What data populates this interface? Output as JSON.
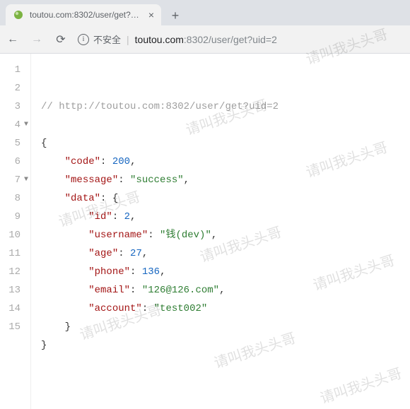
{
  "tab": {
    "title": "toutou.com:8302/user/get?uid=2",
    "close": "×"
  },
  "newTab": "+",
  "nav": {
    "back": "←",
    "forward": "→",
    "reload": "⟳"
  },
  "siteInfo": {
    "icon": "i",
    "label": "不安全"
  },
  "url": {
    "host": "toutou.com",
    "port": ":8302",
    "path": "/user/get?uid=2"
  },
  "watermark": "请叫我头头哥",
  "code": {
    "commentPrefix": "// ",
    "commentUrl": "http://toutou.com:8302/user/get?uid=2",
    "braceOpen": "{",
    "braceClose": "}",
    "comma": ",",
    "colon": ": ",
    "keys": {
      "code": "\"code\"",
      "message": "\"message\"",
      "data": "\"data\"",
      "id": "\"id\"",
      "username": "\"username\"",
      "age": "\"age\"",
      "phone": "\"phone\"",
      "email": "\"email\"",
      "account": "\"account\""
    },
    "values": {
      "code": "200",
      "message": "\"success\"",
      "id": "2",
      "username": "\"钱(dev)\"",
      "age": "27",
      "phone": "136",
      "email": "\"126@126.com\"",
      "account": "\"test002\""
    }
  },
  "lineNumbers": [
    "1",
    "2",
    "3",
    "4",
    "5",
    "6",
    "7",
    "8",
    "9",
    "10",
    "11",
    "12",
    "13",
    "14",
    "15"
  ]
}
